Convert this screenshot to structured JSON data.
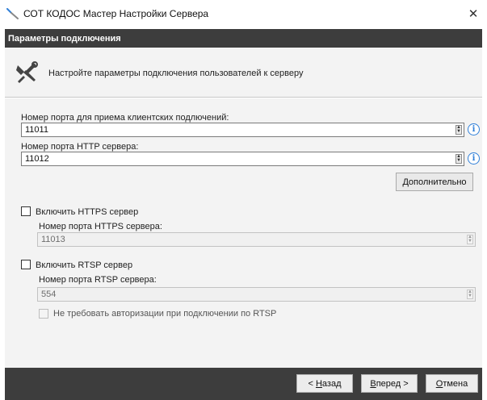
{
  "window": {
    "title": "СОТ КОДОС Мастер Настройки Сервера",
    "close_label": "✕"
  },
  "header": {
    "title": "Параметры подключения"
  },
  "banner": {
    "text": "Настройте параметры подключения пользователей к серверу"
  },
  "client_port": {
    "label": "Номер порта для приема клиентских подлючений:",
    "value": "11011"
  },
  "http_port": {
    "label": "Номер порта HTTP сервера:",
    "value": "11012"
  },
  "advanced_button": {
    "accel": "Д",
    "rest": "ополнительно"
  },
  "https": {
    "checkbox_label": "Включить HTTPS сервер",
    "port_label": "Номер порта HTTPS сервера:",
    "port_value": "11013",
    "enabled": false
  },
  "rtsp": {
    "checkbox_label": "Включить RTSP сервер",
    "port_label": "Номер порта RTSP сервера:",
    "port_value": "554",
    "no_auth_label": "Не требовать авторизации при подключении по RTSP",
    "enabled": false
  },
  "footer": {
    "back": {
      "prefix": "< ",
      "accel": "Н",
      "rest": "азад"
    },
    "next": {
      "accel": "В",
      "rest": "перед >"
    },
    "cancel": {
      "accel": "О",
      "rest": "тмена"
    }
  },
  "colors": {
    "dark_bar": "#3d3d3d",
    "panel_bg": "#f3f3f3",
    "info_blue": "#2f7fd8"
  },
  "icons": {
    "app": "wrench-icon",
    "banner": "tools-icon",
    "info": "info-icon",
    "spin": "spinner-arrows-icon"
  }
}
